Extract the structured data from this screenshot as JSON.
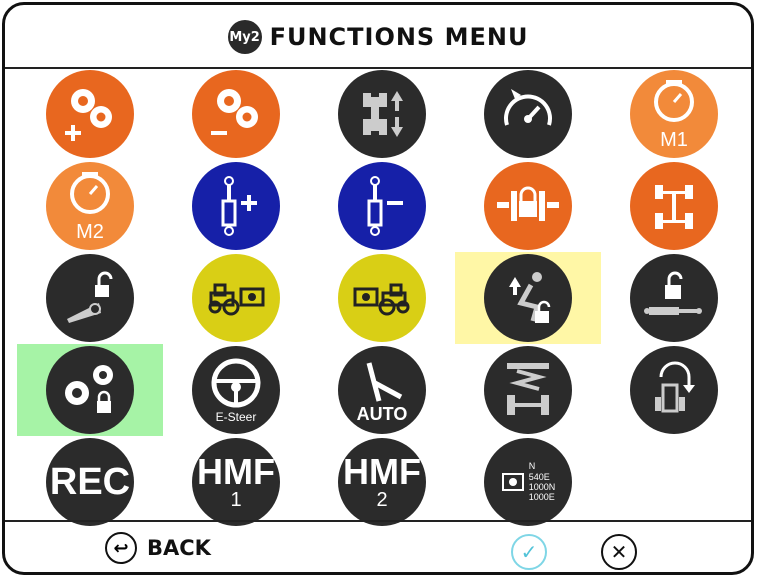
{
  "header": {
    "logo_text": "My2",
    "title": "FUNCTIONS MENU"
  },
  "colors": {
    "orange": "#e8671f",
    "light_orange": "#f28a3a",
    "blue": "#1620a8",
    "dark": "#2b2b2b",
    "yellow": "#d9cf15",
    "highlight_yellow": "#fff7a6",
    "highlight_green": "#a6f3a6"
  },
  "functions": [
    {
      "icon": "gears-plus-icon"
    },
    {
      "icon": "gears-minus-icon"
    },
    {
      "icon": "tractor-axle-up-down-icon"
    },
    {
      "icon": "speedometer-icon"
    },
    {
      "icon": "engine-memory-m1-icon",
      "label": "M1"
    },
    {
      "icon": "engine-memory-m2-icon",
      "label": "M2"
    },
    {
      "icon": "hydraulic-cylinder-plus-icon"
    },
    {
      "icon": "hydraulic-cylinder-minus-icon"
    },
    {
      "icon": "differential-lock-icon"
    },
    {
      "icon": "four-wheel-drive-icon"
    },
    {
      "icon": "hitch-lock-icon"
    },
    {
      "icon": "tractor-front-pto-icon"
    },
    {
      "icon": "tractor-rear-pto-icon"
    },
    {
      "icon": "seat-lock-icon"
    },
    {
      "icon": "cylinder-lock-icon"
    },
    {
      "icon": "gears-lock-icon"
    },
    {
      "icon": "steering-wheel-icon",
      "label": "E-Steer"
    },
    {
      "icon": "auto-steer-icon",
      "label": "AUTO"
    },
    {
      "icon": "axle-suspension-icon"
    },
    {
      "icon": "tractor-turn-icon"
    },
    {
      "icon": "record-icon",
      "label": "REC"
    },
    {
      "icon": "hmf-icon",
      "label": "HMF",
      "sub": "1"
    },
    {
      "icon": "hmf-icon",
      "label": "HMF",
      "sub": "2"
    },
    {
      "icon": "pto-speed-icon",
      "lines": [
        "N",
        "540E",
        "1000N",
        "1000E"
      ]
    }
  ],
  "footer": {
    "back_label": "BACK",
    "back_icon": "back-arrow-icon",
    "ok_icon": "check-icon",
    "cancel_icon": "close-icon"
  }
}
